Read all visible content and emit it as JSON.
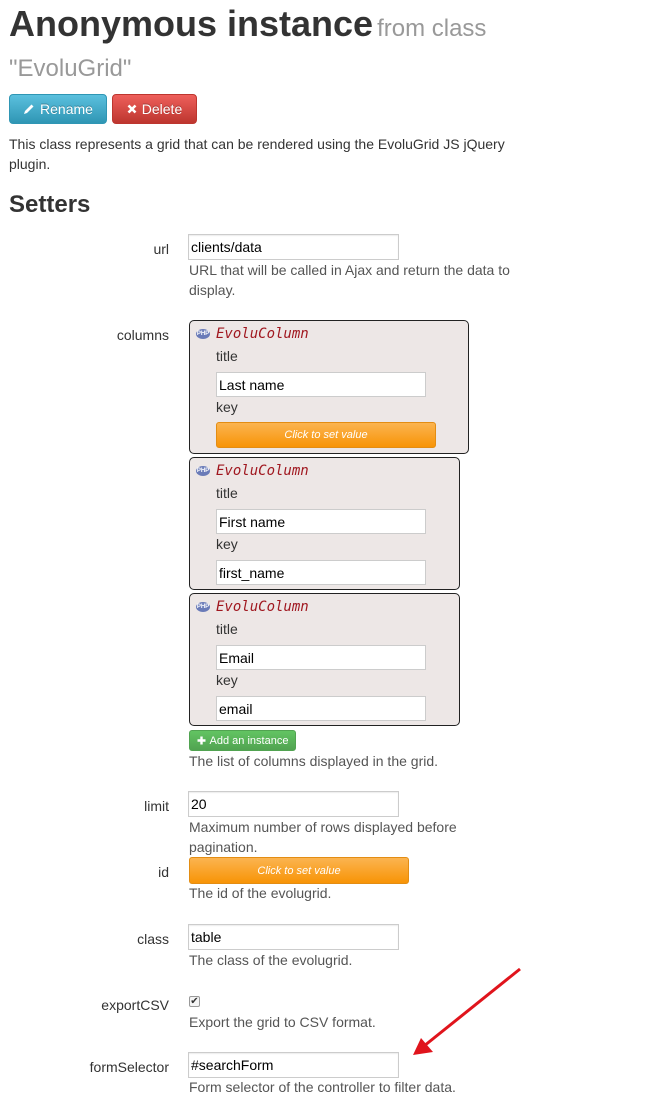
{
  "header": {
    "title": "Anonymous instance",
    "title_suffix": "from class",
    "class_name": "\"EvoluGrid\"",
    "description": "This class represents a grid that can be rendered using the EvoluGrid JS jQuery plugin."
  },
  "buttons": {
    "rename_label": "Rename",
    "delete_label": "Delete"
  },
  "setters_heading": "Setters",
  "fields": {
    "url": {
      "label": "url",
      "value": "clients/data",
      "help": "URL that will be called in Ajax and return the data to display."
    },
    "columns": {
      "label": "columns",
      "instances": [
        {
          "class": "EvoluColumn",
          "title_label": "title",
          "title_value": "Last name",
          "key_label": "key",
          "key_value": "",
          "key_button": "Click to set value"
        },
        {
          "class": "EvoluColumn",
          "title_label": "title",
          "title_value": "First name",
          "key_label": "key",
          "key_value": "first_name"
        },
        {
          "class": "EvoluColumn",
          "title_label": "title",
          "title_value": "Email",
          "key_label": "key",
          "key_value": "email"
        }
      ],
      "add_label": "Add an instance",
      "help": "The list of columns displayed in the grid."
    },
    "limit": {
      "label": "limit",
      "value": "20",
      "help": "Maximum number of rows displayed before pagination."
    },
    "id": {
      "label": "id",
      "button": "Click to set value",
      "help": "The id of the evolugrid."
    },
    "class": {
      "label": "class",
      "value": "table",
      "help": "The class of the evolugrid."
    },
    "exportCSV": {
      "label": "exportCSV",
      "checked": true,
      "help": "Export the grid to CSV format."
    },
    "formSelector": {
      "label": "formSelector",
      "value": "#searchForm",
      "help": "Form selector of the controller to filter data."
    }
  },
  "colors": {
    "info": "#2f96b4",
    "danger": "#bd362f",
    "warning": "#f89406",
    "success": "#51a351",
    "class_name": "#a0171f",
    "annotation_arrow": "#e0141c"
  }
}
